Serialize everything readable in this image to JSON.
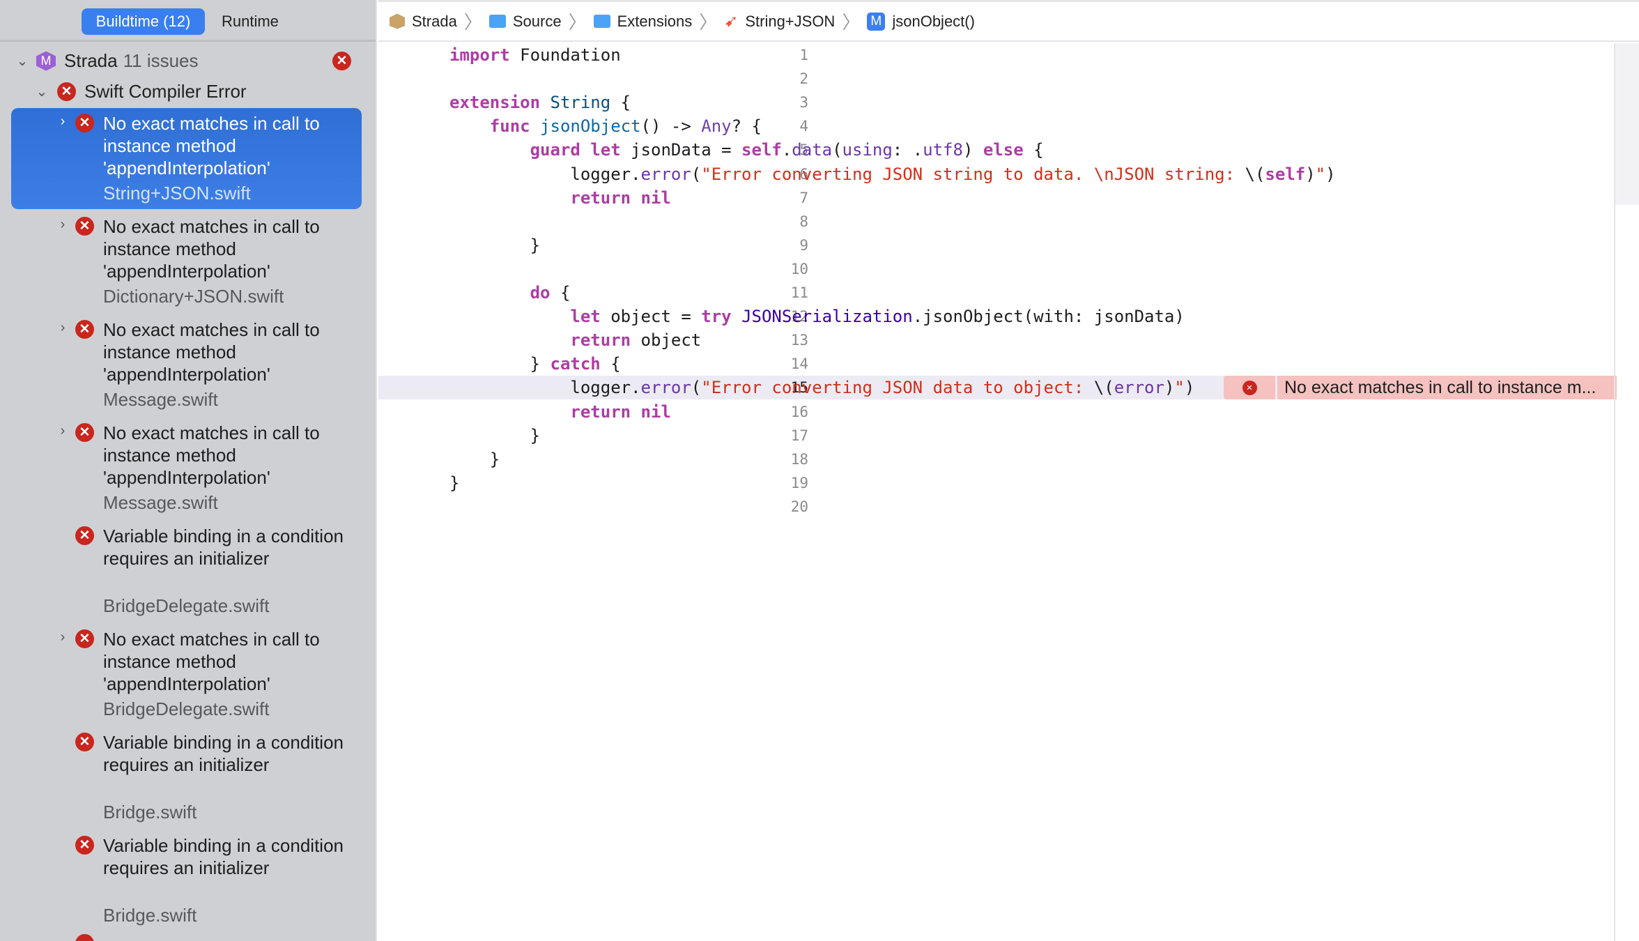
{
  "sidebar": {
    "tabs": [
      "Buildtime (12)",
      "Runtime"
    ],
    "project": {
      "name": "Strada",
      "count": "11 issues",
      "icon": "M"
    },
    "group": "Swift Compiler Error",
    "items": [
      {
        "msg": "No exact matches in call to instance method 'appendInterpolation'",
        "file": "String+JSON.swift",
        "chevron": true,
        "selected": true
      },
      {
        "msg": "No exact matches in call to instance method 'appendInterpolation'",
        "file": "Dictionary+JSON.swift",
        "chevron": true
      },
      {
        "msg": "No exact matches in call to instance method 'appendInterpolation'",
        "file": "Message.swift",
        "chevron": true
      },
      {
        "msg": "No exact matches in call to instance method 'appendInterpolation'",
        "file": "Message.swift",
        "chevron": true
      },
      {
        "msg": "Variable binding in a condition requires an initializer",
        "file": "BridgeDelegate.swift",
        "chevron": false
      },
      {
        "msg": "No exact matches in call to instance method 'appendInterpolation'",
        "file": "BridgeDelegate.swift",
        "chevron": true
      },
      {
        "msg": "Variable binding in a condition requires an initializer",
        "file": "Bridge.swift",
        "chevron": false
      },
      {
        "msg": "Variable binding in a condition requires an initializer",
        "file": "Bridge.swift",
        "chevron": false
      }
    ]
  },
  "breadcrumb": [
    "Strada",
    "Source",
    "Extensions",
    "String+JSON",
    "jsonObject()"
  ],
  "editor": {
    "current_line": 15,
    "error_annotation": "No exact matches in call to instance m...",
    "lines": [
      [
        [
          "k",
          "import"
        ],
        [
          "",
          "Foundation"
        ]
      ],
      [],
      [
        [
          "k",
          "extension"
        ],
        [
          "",
          "String"
        ],
        [
          "",
          ""
        ]
      ],
      [
        [
          "",
          "    "
        ],
        [
          "k",
          "func"
        ],
        [
          "",
          "jsonObject"
        ],
        [
          "",
          "() -> "
        ],
        [
          "ty",
          "Any"
        ],
        [
          "",
          "? {"
        ]
      ],
      [],
      [],
      [],
      [],
      [],
      [],
      [],
      [],
      [],
      [],
      [],
      [],
      [],
      [],
      [],
      []
    ],
    "code": [
      [
        [
          "k",
          "import"
        ],
        [
          "",
          " Foundation"
        ]
      ],
      [],
      [
        [
          "k",
          "extension"
        ],
        [
          "",
          " "
        ],
        [
          "t",
          "String"
        ],
        [
          "",
          " {"
        ]
      ],
      [
        [
          "",
          "    "
        ],
        [
          "k",
          "func"
        ],
        [
          "",
          " "
        ],
        [
          "d",
          "jsonObject"
        ],
        [
          "",
          "() -> "
        ],
        [
          "ty",
          "Any"
        ],
        [
          "",
          "? {"
        ]
      ],
      [
        [
          "",
          "        "
        ],
        [
          "k",
          "guard"
        ],
        [
          "",
          " "
        ],
        [
          "k",
          "let"
        ],
        [
          "",
          " jsonData = "
        ],
        [
          "k",
          "self"
        ],
        [
          "",
          "."
        ],
        [
          "m",
          "data"
        ],
        [
          "",
          "("
        ],
        [
          "m",
          "using"
        ],
        [
          "",
          ": ."
        ],
        [
          "m",
          "utf8"
        ],
        [
          "",
          ") "
        ],
        [
          "k",
          "else"
        ],
        [
          "",
          " {"
        ]
      ],
      [
        [
          "",
          "            logger."
        ],
        [
          "m",
          "error"
        ],
        [
          "",
          "("
        ],
        [
          "s",
          "\"Error converting JSON string to data. \\nJSON string: "
        ],
        [
          "",
          "\\("
        ],
        [
          "k",
          "self"
        ],
        [
          "",
          ")"
        ],
        [
          "s",
          "\""
        ],
        [
          "",
          ")"
        ]
      ],
      [
        [
          "",
          "            "
        ],
        [
          "k",
          "return"
        ],
        [
          "",
          " "
        ],
        [
          "k",
          "nil"
        ]
      ],
      [],
      [
        [
          "",
          "        }"
        ]
      ],
      [],
      [
        [
          "",
          "        "
        ],
        [
          "k",
          "do"
        ],
        [
          "",
          " {"
        ]
      ],
      [
        [
          "",
          "            "
        ],
        [
          "k",
          "let"
        ],
        [
          "",
          " object = "
        ],
        [
          "k",
          "try"
        ],
        [
          "",
          " "
        ],
        [
          "c",
          "JSONSerialization"
        ],
        [
          "",
          ".jsonObject(with: jsonData)"
        ]
      ],
      [
        [
          "",
          "            "
        ],
        [
          "k",
          "return"
        ],
        [
          "",
          " object"
        ]
      ],
      [
        [
          "",
          "        } "
        ],
        [
          "k",
          "catch"
        ],
        [
          "",
          " {"
        ]
      ],
      [
        [
          "",
          "            logger."
        ],
        [
          "m",
          "error"
        ],
        [
          "",
          "("
        ],
        [
          "s",
          "\"Error converting JSON data to object: "
        ],
        [
          "",
          "\\("
        ],
        [
          "m",
          "error"
        ],
        [
          "",
          ")"
        ],
        [
          "s",
          "\""
        ],
        [
          "",
          ")"
        ]
      ],
      [
        [
          "",
          "            "
        ],
        [
          "k",
          "return"
        ],
        [
          "",
          " "
        ],
        [
          "k",
          "nil"
        ]
      ],
      [
        [
          "",
          "        }"
        ]
      ],
      [
        [
          "",
          "    }"
        ]
      ],
      [
        [
          "",
          "}"
        ]
      ],
      []
    ]
  },
  "colors": {
    "accent": "#3a7fef",
    "error": "#c8261e",
    "error_bg": "#f5c2c0"
  }
}
